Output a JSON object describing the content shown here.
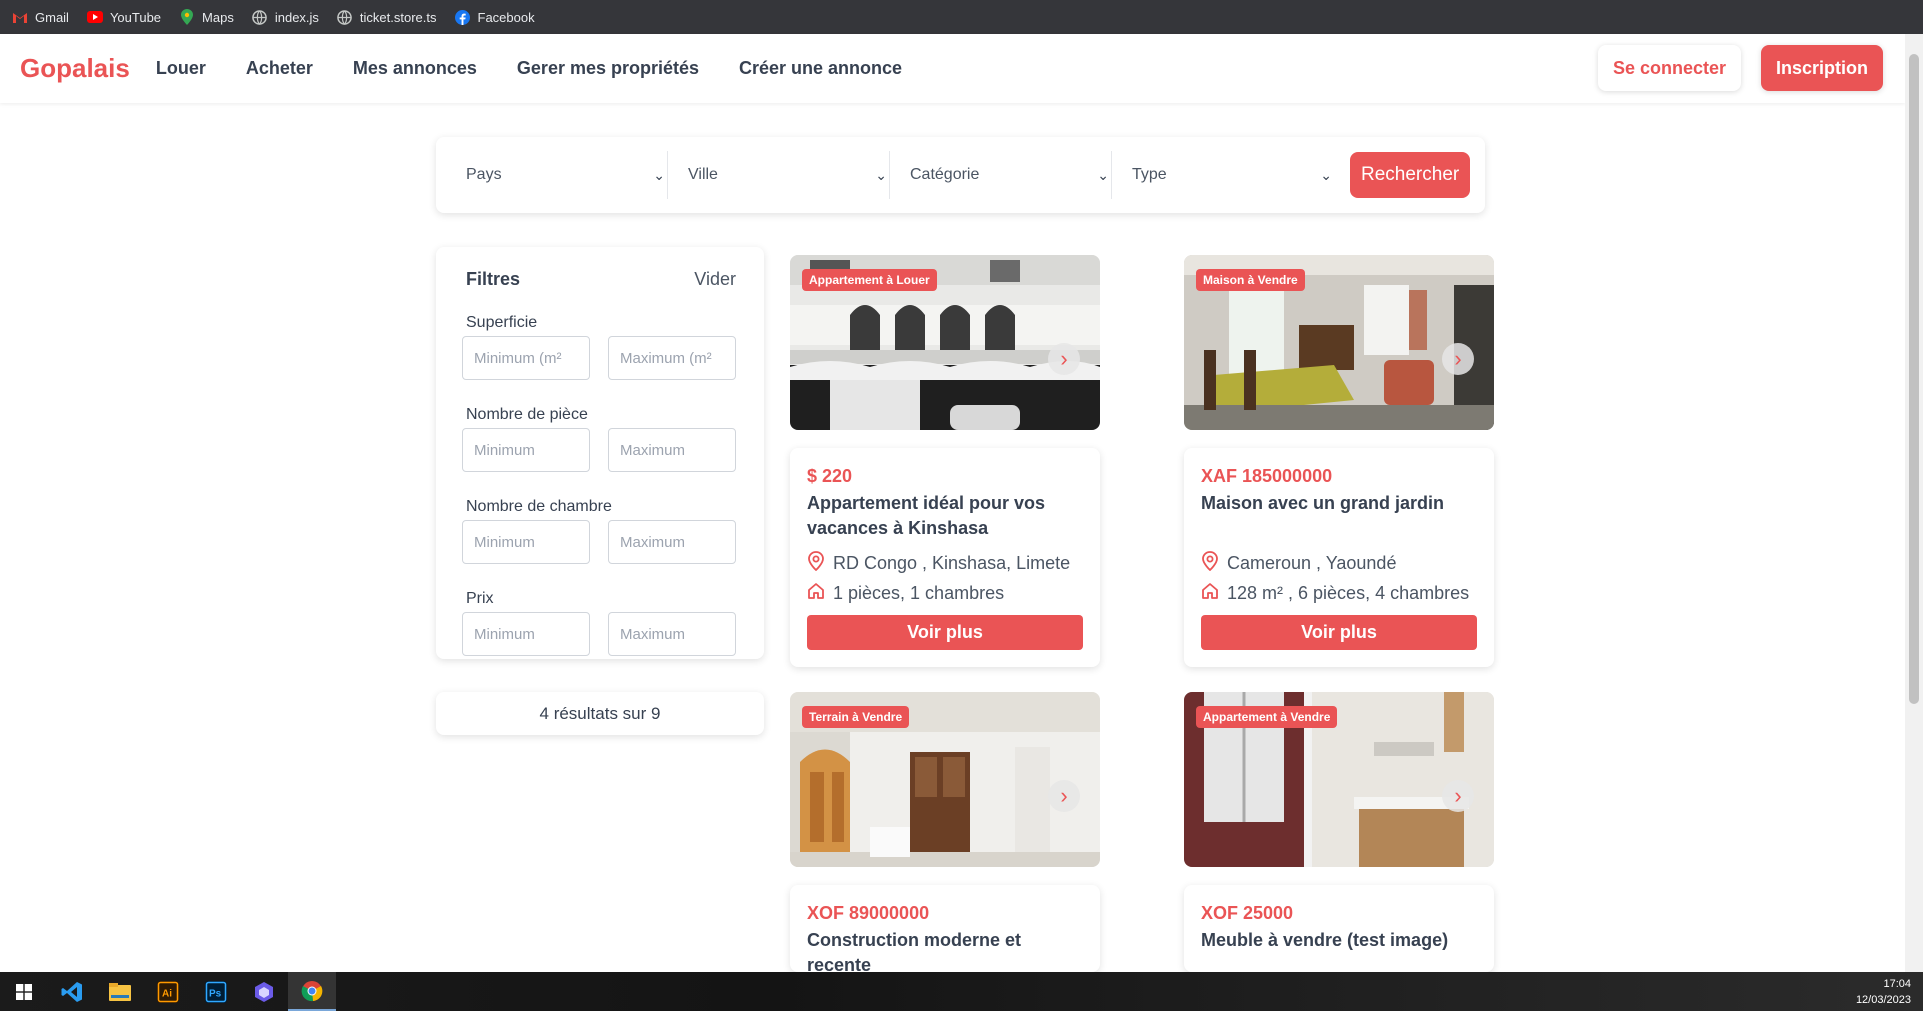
{
  "bookmarks": [
    {
      "label": "Gmail",
      "icon": "gmail-icon"
    },
    {
      "label": "YouTube",
      "icon": "youtube-icon"
    },
    {
      "label": "Maps",
      "icon": "maps-icon"
    },
    {
      "label": "index.js",
      "icon": "globe-icon"
    },
    {
      "label": "ticket.store.ts",
      "icon": "globe-icon"
    },
    {
      "label": "Facebook",
      "icon": "facebook-icon"
    }
  ],
  "nav": {
    "brand": "Gopalais",
    "links": [
      "Louer",
      "Acheter",
      "Mes annonces",
      "Gerer mes propriétés",
      "Créer une annonce"
    ],
    "login": "Se connecter",
    "signup": "Inscription"
  },
  "search": {
    "selects": [
      "Pays",
      "Ville",
      "Catégorie",
      "Type"
    ],
    "button": "Rechercher"
  },
  "filters": {
    "title": "Filtres",
    "clear": "Vider",
    "groups": [
      {
        "label": "Superficie",
        "min": "Minimum (m²",
        "max": "Maximum (m²"
      },
      {
        "label": "Nombre de pièce",
        "min": "Minimum",
        "max": "Maximum"
      },
      {
        "label": "Nombre de chambre",
        "min": "Minimum",
        "max": "Maximum"
      },
      {
        "label": "Prix",
        "min": "Minimum",
        "max": "Maximum"
      }
    ]
  },
  "results": "4 résultats sur 9",
  "listings": [
    {
      "tag": "Appartement à Louer",
      "price": "$ 220",
      "title": "Appartement idéal pour vos vacances à Kinshasa",
      "location": "RD Congo , Kinshasa, Limete",
      "details": "1 pièces, 1 chambres",
      "button": "Voir plus"
    },
    {
      "tag": "Maison à Vendre",
      "price": "XAF 185000000",
      "title": "Maison avec un grand jardin",
      "location": "Cameroun , Yaoundé",
      "details": "128 m² , 6 pièces, 4 chambres",
      "button": "Voir plus"
    },
    {
      "tag": "Terrain à Vendre",
      "price": "XOF 89000000",
      "title": "Construction moderne et recente"
    },
    {
      "tag": "Appartement à Vendre",
      "price": "XOF 25000",
      "title": "Meuble à vendre (test image)"
    }
  ],
  "colors": {
    "accent": "#ea5455"
  },
  "taskbar": {
    "apps": [
      "windows-start-icon",
      "vscode-icon",
      "file-explorer-icon",
      "illustrator-icon",
      "photoshop-icon",
      "app-icon",
      "chrome-icon"
    ],
    "time": "17:04",
    "date": "12/03/2023"
  }
}
